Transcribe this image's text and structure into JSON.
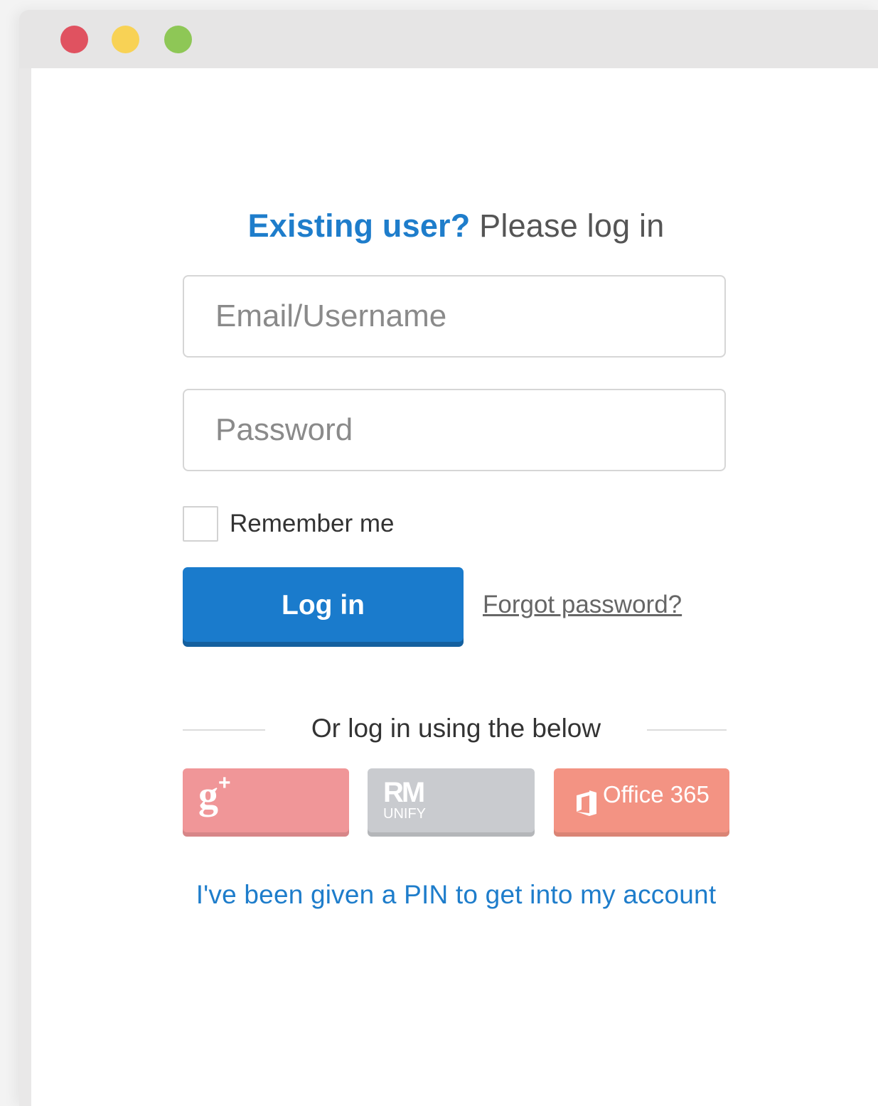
{
  "colors": {
    "window_red": "#e05260",
    "window_yellow": "#f8d255",
    "window_green": "#8ec756",
    "accent_blue": "#1e7dcb",
    "login_button": "#1a7bcc",
    "google_button": "#f09698",
    "rm_button": "#c9cbcf",
    "office_button": "#f39383"
  },
  "header": {
    "accent_text": "Existing user?",
    "rest_text": " Please log in"
  },
  "form": {
    "email_placeholder": "Email/Username",
    "password_placeholder": "Password",
    "remember_label": "Remember me",
    "remember_checked": false,
    "login_label": "Log in",
    "forgot_label": "Forgot password?"
  },
  "divider": {
    "text": "Or log in using the below"
  },
  "social": {
    "google": {
      "icon": "google-plus-icon",
      "glyph": "g",
      "plus": "+"
    },
    "rm": {
      "icon": "rm-unify-logo",
      "main": "RM",
      "sub": "UNIFY"
    },
    "office": {
      "icon": "office-icon",
      "label": "Office 365"
    }
  },
  "pin_link": "I've been given a PIN to get into my account"
}
